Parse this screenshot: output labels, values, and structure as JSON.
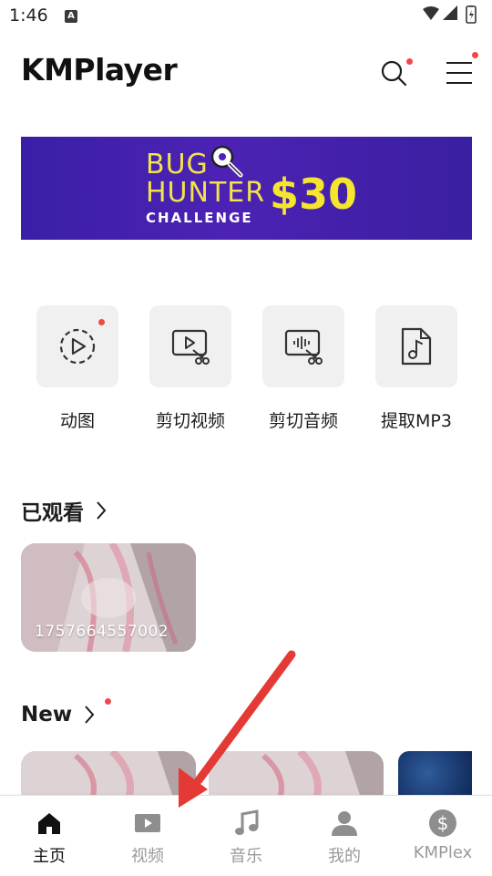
{
  "status_bar": {
    "time": "1:46",
    "notification_icon_letter": "A"
  },
  "header": {
    "logo": "KMPlayer"
  },
  "banner": {
    "line1": "BUG",
    "line2": "HUNTER",
    "line3": "CHALLENGE",
    "amount": "$30"
  },
  "tools": [
    {
      "label": "动图",
      "icon": "gif-play-icon"
    },
    {
      "label": "剪切视频",
      "icon": "video-cut-icon"
    },
    {
      "label": "剪切音频",
      "icon": "audio-cut-icon"
    },
    {
      "label": "提取MP3",
      "icon": "music-file-icon"
    }
  ],
  "watched": {
    "title": "已观看",
    "items": [
      {
        "caption": "1757664557002"
      }
    ]
  },
  "new_section": {
    "title": "New"
  },
  "bottom_nav": [
    {
      "label": "主页",
      "icon": "home-icon",
      "active": true
    },
    {
      "label": "视频",
      "icon": "video-icon",
      "active": false
    },
    {
      "label": "音乐",
      "icon": "music-note-icon",
      "active": false
    },
    {
      "label": "我的",
      "icon": "person-icon",
      "active": false
    },
    {
      "label": "KMPlex",
      "icon": "dollar-icon",
      "active": false
    }
  ],
  "colors": {
    "accent_dot": "#f04848",
    "banner_bg": "#4c22b4",
    "banner_text": "#f5e52e",
    "annotation_arrow": "#e53935"
  }
}
